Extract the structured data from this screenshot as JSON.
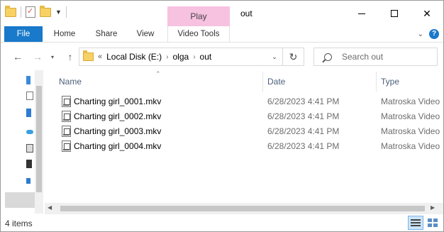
{
  "title_bar": {
    "window_title": "out",
    "contextual_tab": "Play"
  },
  "ribbon": {
    "tabs": [
      "File",
      "Home",
      "Share",
      "View",
      "Video Tools"
    ]
  },
  "address_bar": {
    "overflow": "«",
    "crumbs": [
      "Local Disk (E:)",
      "olga",
      "out"
    ]
  },
  "search": {
    "placeholder": "Search out"
  },
  "columns": {
    "name": "Name",
    "date": "Date",
    "type": "Type"
  },
  "files": [
    {
      "name": "Charting girl_0001.mkv",
      "date": "6/28/2023 4:41 PM",
      "type": "Matroska Video"
    },
    {
      "name": "Charting girl_0002.mkv",
      "date": "6/28/2023 4:41 PM",
      "type": "Matroska Video"
    },
    {
      "name": "Charting girl_0003.mkv",
      "date": "6/28/2023 4:41 PM",
      "type": "Matroska Video"
    },
    {
      "name": "Charting girl_0004.mkv",
      "date": "6/28/2023 4:41 PM",
      "type": "Matroska Video"
    }
  ],
  "status": {
    "item_count": "4 items"
  },
  "colors": {
    "file_tab": "#1979ca",
    "play_tab": "#f7c1e0",
    "column_header": "#4c607a"
  }
}
